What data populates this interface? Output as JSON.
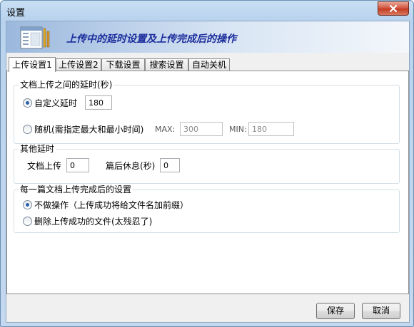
{
  "window": {
    "title": "设置"
  },
  "banner": {
    "title": "上传中的延时设置及上传完成后的操作"
  },
  "tabs": [
    "上传设置1",
    "上传设置2",
    "下载设置",
    "搜索设置",
    "自动关机"
  ],
  "delay_group": {
    "title": "文档上传之间的延时(秒)",
    "custom_label": "自定义延时",
    "custom_value": "180",
    "random_label": "随机(需指定最大和最小时间)",
    "max_label": "MAX:",
    "max_value": "300",
    "min_label": "MIN:",
    "min_value": "180"
  },
  "other_group": {
    "title": "其他延时",
    "upload_label": "文档上传",
    "upload_value": "0",
    "rest_label": "篇后休息(秒)",
    "rest_value": "0"
  },
  "after_group": {
    "title": "每一篇文档上传完成后的设置",
    "option1": "不做操作（上传成功将给文件名加前缀）",
    "option2": "删除上传成功的文件(太残忍了)"
  },
  "buttons": {
    "save": "保存",
    "cancel": "取消"
  }
}
